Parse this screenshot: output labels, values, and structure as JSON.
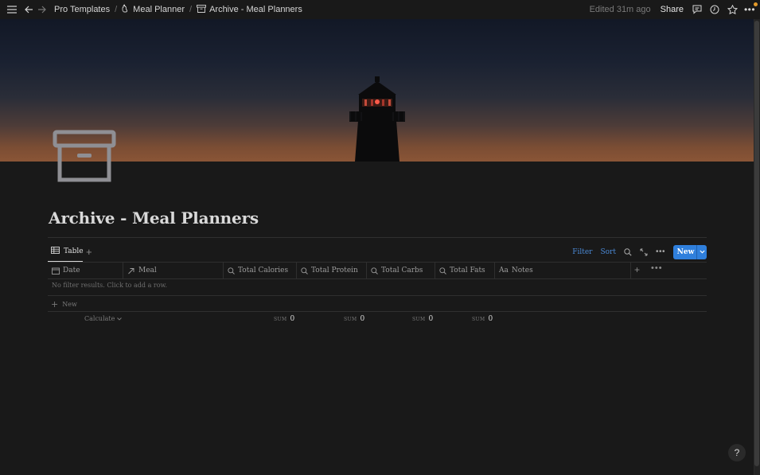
{
  "topbar": {
    "breadcrumb": [
      {
        "label": "Pro Templates",
        "icon": "none"
      },
      {
        "label": "Meal Planner",
        "icon": "hand-icon"
      },
      {
        "label": "Archive - Meal Planners",
        "icon": "archive-icon"
      }
    ],
    "edited": "Edited 31m ago",
    "share": "Share"
  },
  "page": {
    "title": "Archive - Meal Planners",
    "icon": "archive-box-icon"
  },
  "view": {
    "tab_label": "Table",
    "filter": "Filter",
    "sort": "Sort",
    "new_label": "New"
  },
  "table": {
    "columns": [
      {
        "label": "Date",
        "icon": "calendar-icon"
      },
      {
        "label": "Meal",
        "icon": "relation-arrow-icon"
      },
      {
        "label": "Total Calories",
        "icon": "search-formula-icon"
      },
      {
        "label": "Total Protein",
        "icon": "search-formula-icon"
      },
      {
        "label": "Total Carbs",
        "icon": "search-formula-icon"
      },
      {
        "label": "Total Fats",
        "icon": "search-formula-icon"
      },
      {
        "label": "Notes",
        "icon": "text-aa-icon"
      }
    ],
    "empty_message": "No filter results. Click to add a row.",
    "new_row": "New",
    "calculate": "Calculate",
    "sums": [
      {
        "key": "SUM",
        "value": "0"
      },
      {
        "key": "SUM",
        "value": "0"
      },
      {
        "key": "SUM",
        "value": "0"
      },
      {
        "key": "SUM",
        "value": "0"
      }
    ]
  },
  "help": "?",
  "colors": {
    "accent": "#2f7fdc",
    "link": "#4b8ad8",
    "background": "#191919"
  }
}
